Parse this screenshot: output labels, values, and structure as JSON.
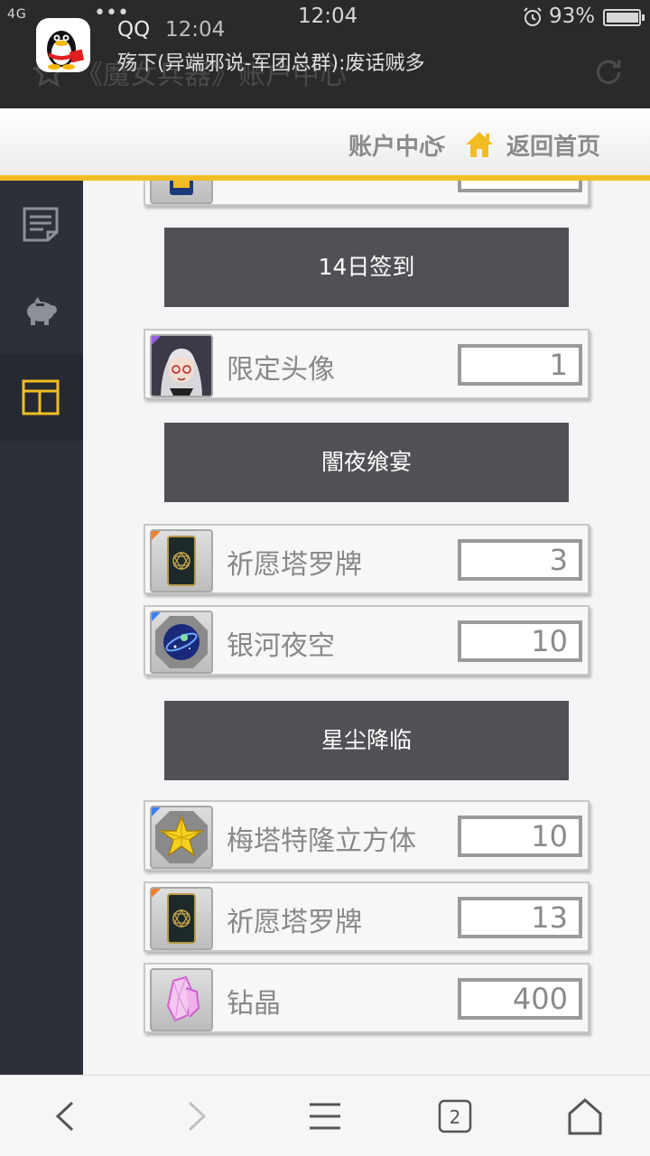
{
  "status": {
    "network": "4G",
    "dots": "•••",
    "time": "12:04",
    "battery": "93%",
    "battery_level": 0.93
  },
  "notification": {
    "app": "QQ",
    "time": "12:04",
    "message": "殇下(异端邪说-军团总群):废话贼多"
  },
  "underlying": {
    "title": "《魔女兵器》账户中心"
  },
  "header": {
    "title": "账户中心",
    "separator": "<",
    "home": "返回首页",
    "accent": "#f2bd23"
  },
  "sidebar": {
    "items": [
      {
        "icon": "document-icon",
        "active": false
      },
      {
        "icon": "piggy-bank-icon",
        "active": false
      },
      {
        "icon": "layout-icon",
        "active": true
      }
    ]
  },
  "sections": [
    {
      "label": "14日签到"
    },
    {
      "label": "闇夜飨宴"
    },
    {
      "label": "星尘降临"
    }
  ],
  "items": [
    {
      "name": "限定头像",
      "qty": "1",
      "icon": "avatar-portrait-icon"
    },
    {
      "name": "祈愿塔罗牌",
      "qty": "3",
      "icon": "tarot-card-icon"
    },
    {
      "name": "银河夜空",
      "qty": "10",
      "icon": "galaxy-orb-icon"
    },
    {
      "name": "梅塔特隆立方体",
      "qty": "10",
      "icon": "star-cube-icon"
    },
    {
      "name": "祈愿塔罗牌",
      "qty": "13",
      "icon": "tarot-card-icon"
    },
    {
      "name": "钻晶",
      "qty": "400",
      "icon": "crystal-icon"
    }
  ],
  "bottom_nav": {
    "tabs_count": "2"
  }
}
